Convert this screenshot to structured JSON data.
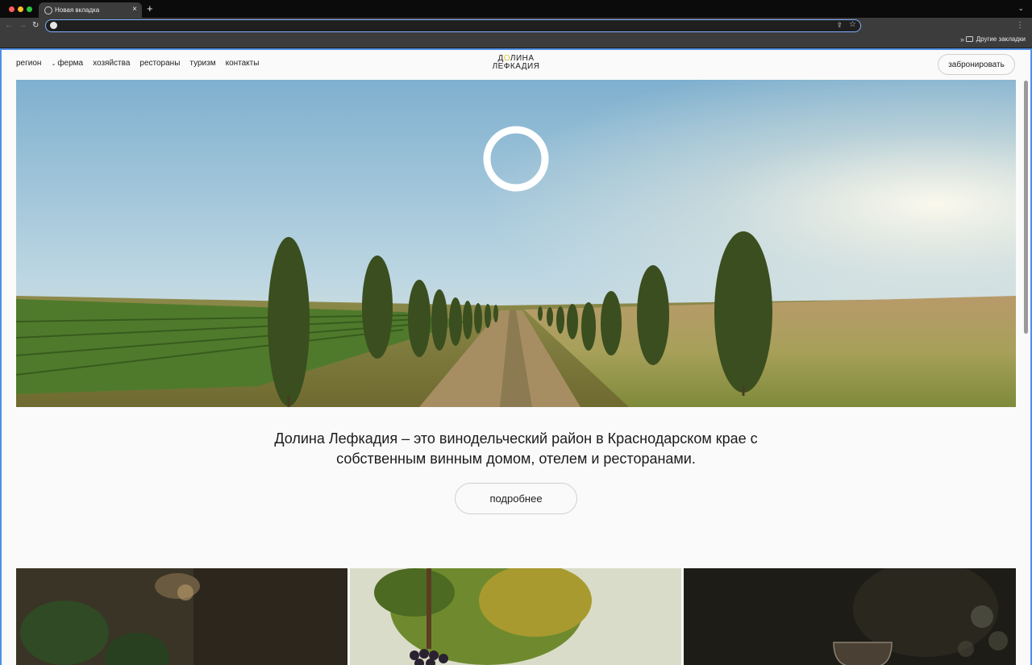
{
  "browser": {
    "tab_title": "Новая вкладка",
    "tab_close_glyph": "×",
    "new_tab_glyph": "+",
    "tabbar_chevron_glyph": "⌄",
    "back_glyph": "←",
    "forward_glyph": "→",
    "reload_glyph": "↻",
    "address_value": "",
    "share_glyph": "⇪",
    "star_glyph": "☆",
    "menu_glyph": "⋮",
    "bookmarks_more_glyph": "»",
    "bookmarks_folder_label": "Другие закладки"
  },
  "site": {
    "nav": {
      "items": [
        {
          "label": "регион"
        },
        {
          "label": "ферма",
          "chevron": "⌄"
        },
        {
          "label": "хозяйства"
        },
        {
          "label": "рестораны"
        },
        {
          "label": "туризм"
        },
        {
          "label": "контакты"
        }
      ]
    },
    "logo": {
      "line1_prefix": "Д",
      "line1_o": "О",
      "line1_suffix": "ЛИНА",
      "line2": "ЛЕФКАДИЯ"
    },
    "book_button": "забронировать",
    "intro_text": "Долина Лефкадия – это винодельческий район в Краснодарском крае с собственным винным домом, отелем и ресторанами.",
    "more_button": "подробнее"
  },
  "colors": {
    "accent_focus": "#4f8fe8",
    "logo_accent": "#e2c43a",
    "page_bg": "#fafafa"
  },
  "icons": [
    "chrome-tab-icon",
    "close-icon",
    "plus-icon",
    "back-arrow-icon",
    "forward-arrow-icon",
    "reload-icon",
    "share-icon",
    "star-icon",
    "kebab-menu-icon",
    "chevron-double-right-icon",
    "folder-icon",
    "chevron-down-icon",
    "ring-logo-icon"
  ]
}
